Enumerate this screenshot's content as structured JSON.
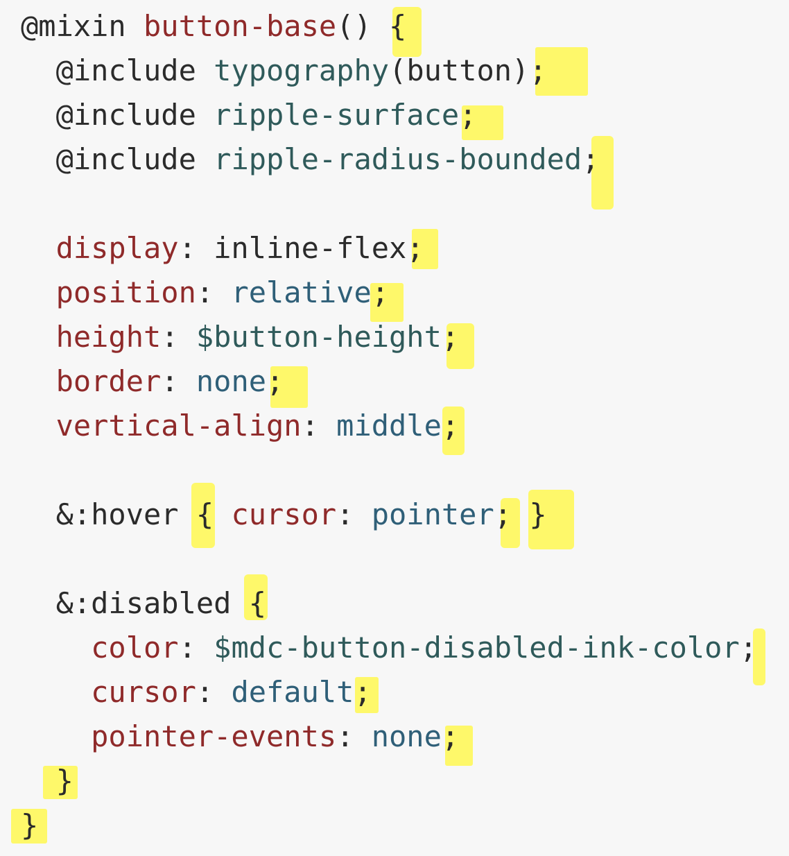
{
  "code": {
    "lines": [
      {
        "parts": [
          {
            "kind": "at",
            "text": "@mixin"
          },
          {
            "kind": "punct",
            "text": " "
          },
          {
            "kind": "name",
            "text": "button-base"
          },
          {
            "kind": "punct",
            "text": "() {"
          }
        ]
      },
      {
        "parts": [
          {
            "kind": "at",
            "text": "  @include"
          },
          {
            "kind": "punct",
            "text": " "
          },
          {
            "kind": "mixin",
            "text": "typography"
          },
          {
            "kind": "punct",
            "text": "(button);"
          }
        ]
      },
      {
        "parts": [
          {
            "kind": "at",
            "text": "  @include"
          },
          {
            "kind": "punct",
            "text": " "
          },
          {
            "kind": "mixin",
            "text": "ripple-surface"
          },
          {
            "kind": "punct",
            "text": ";"
          }
        ]
      },
      {
        "parts": [
          {
            "kind": "at",
            "text": "  @include"
          },
          {
            "kind": "punct",
            "text": " "
          },
          {
            "kind": "mixin",
            "text": "ripple-radius-bounded"
          },
          {
            "kind": "punct",
            "text": ";"
          }
        ]
      },
      {
        "parts": []
      },
      {
        "parts": [
          {
            "kind": "prop",
            "text": "  display"
          },
          {
            "kind": "punct",
            "text": ": inline-flex;"
          }
        ]
      },
      {
        "parts": [
          {
            "kind": "prop",
            "text": "  position"
          },
          {
            "kind": "punct",
            "text": ": "
          },
          {
            "kind": "value",
            "text": "relative"
          },
          {
            "kind": "punct",
            "text": ";"
          }
        ]
      },
      {
        "parts": [
          {
            "kind": "prop",
            "text": "  height"
          },
          {
            "kind": "punct",
            "text": ": "
          },
          {
            "kind": "var",
            "text": "$button-height"
          },
          {
            "kind": "punct",
            "text": ";"
          }
        ]
      },
      {
        "parts": [
          {
            "kind": "prop",
            "text": "  border"
          },
          {
            "kind": "punct",
            "text": ": "
          },
          {
            "kind": "value",
            "text": "none"
          },
          {
            "kind": "punct",
            "text": ";"
          }
        ]
      },
      {
        "parts": [
          {
            "kind": "prop",
            "text": "  vertical-align"
          },
          {
            "kind": "punct",
            "text": ": "
          },
          {
            "kind": "value",
            "text": "middle"
          },
          {
            "kind": "punct",
            "text": ";"
          }
        ]
      },
      {
        "parts": []
      },
      {
        "parts": [
          {
            "kind": "sel",
            "text": "  &:hover"
          },
          {
            "kind": "punct",
            "text": " { "
          },
          {
            "kind": "prop",
            "text": "cursor"
          },
          {
            "kind": "punct",
            "text": ": "
          },
          {
            "kind": "value",
            "text": "pointer"
          },
          {
            "kind": "punct",
            "text": "; }"
          }
        ]
      },
      {
        "parts": []
      },
      {
        "parts": [
          {
            "kind": "sel",
            "text": "  &:disabled"
          },
          {
            "kind": "punct",
            "text": " {"
          }
        ]
      },
      {
        "parts": [
          {
            "kind": "prop",
            "text": "    color"
          },
          {
            "kind": "punct",
            "text": ": "
          },
          {
            "kind": "var",
            "text": "$mdc-button-disabled-ink-color"
          },
          {
            "kind": "punct",
            "text": ";"
          }
        ]
      },
      {
        "parts": [
          {
            "kind": "prop",
            "text": "    cursor"
          },
          {
            "kind": "punct",
            "text": ": "
          },
          {
            "kind": "value",
            "text": "default"
          },
          {
            "kind": "punct",
            "text": ";"
          }
        ]
      },
      {
        "parts": [
          {
            "kind": "prop",
            "text": "    pointer-events"
          },
          {
            "kind": "punct",
            "text": ": "
          },
          {
            "kind": "value",
            "text": "none"
          },
          {
            "kind": "punct",
            "text": ";"
          }
        ]
      },
      {
        "parts": [
          {
            "kind": "punct",
            "text": "  }"
          }
        ]
      },
      {
        "parts": [
          {
            "kind": "punct",
            "text": "}"
          }
        ]
      }
    ]
  },
  "colors": {
    "background": "#f7f7f7",
    "highlight": "#fff84a",
    "keyword": "#2b2b2b",
    "mixin_name": "#8f2a2a",
    "property": "#8f2a2a",
    "value": "#2f5f78",
    "variable": "#2f5a5a"
  }
}
